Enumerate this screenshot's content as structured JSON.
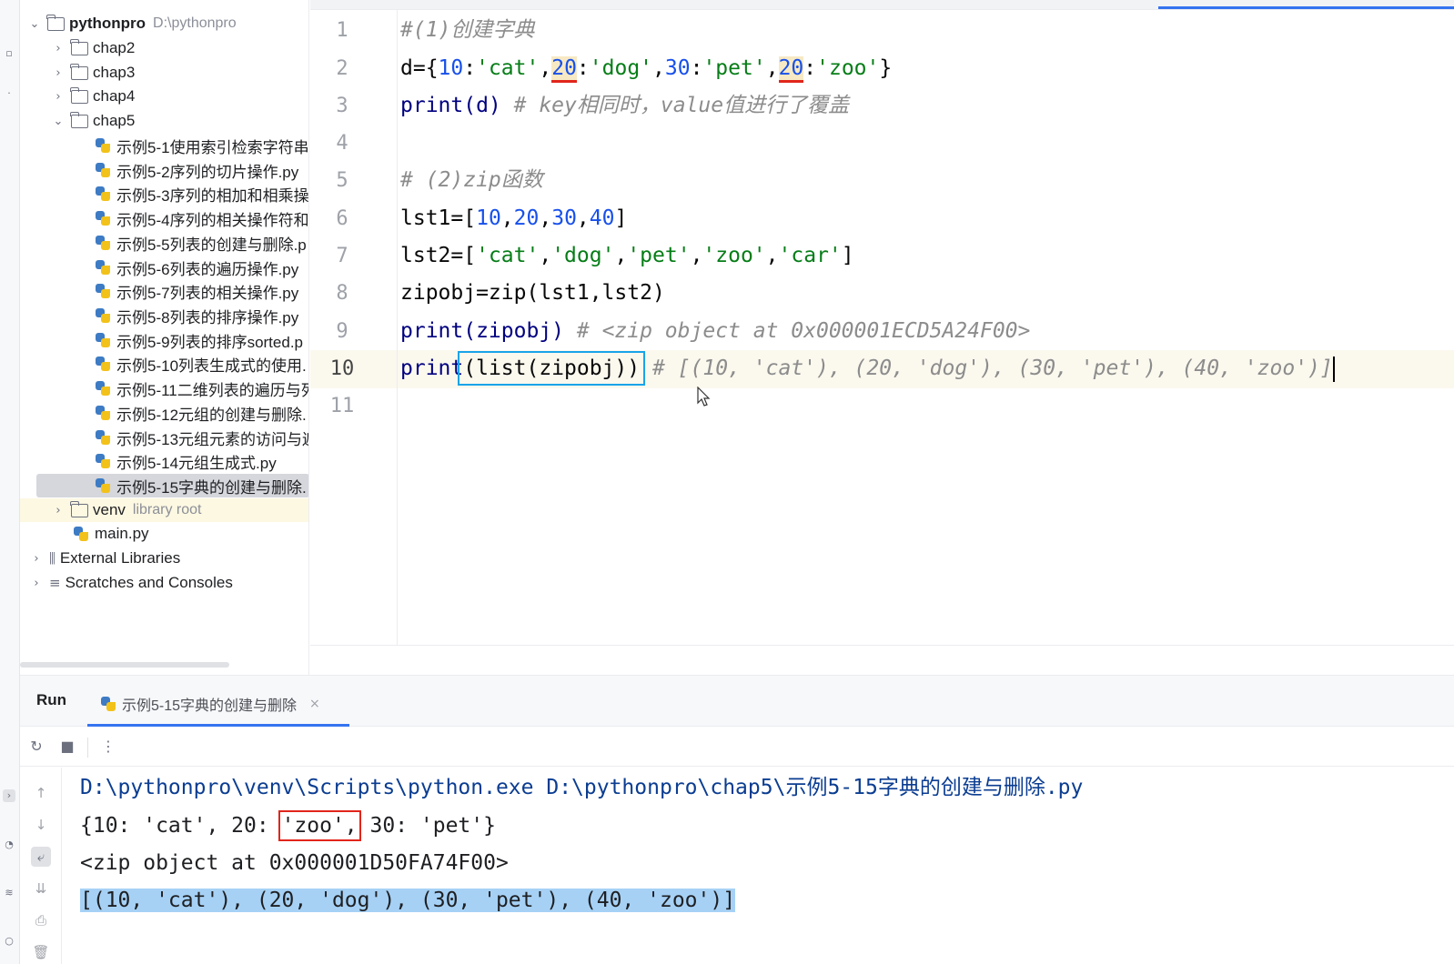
{
  "project": {
    "root_name": "pythonpro",
    "root_path": "D:\\pythonpro",
    "folders": [
      "chap2",
      "chap3",
      "chap4",
      "chap5"
    ],
    "files": [
      "示例5-1使用索引检索字符串",
      "示例5-2序列的切片操作.py",
      "示例5-3序列的相加和相乘操",
      "示例5-4序列的相关操作符和",
      "示例5-5列表的创建与删除.p",
      "示例5-6列表的遍历操作.py",
      "示例5-7列表的相关操作.py",
      "示例5-8列表的排序操作.py",
      "示例5-9列表的排序sorted.p",
      "示例5-10列表生成式的使用.",
      "示例5-11二维列表的遍历与列",
      "示例5-12元组的创建与删除.",
      "示例5-13元组元素的访问与遍",
      "示例5-14元组生成式.py",
      "示例5-15字典的创建与删除."
    ],
    "venv": "venv",
    "venv_hint": "library root",
    "main_file": "main.py",
    "external_libraries": "External Libraries",
    "scratches": "Scratches and Consoles"
  },
  "editor": {
    "line_numbers": [
      "1",
      "2",
      "3",
      "4",
      "5",
      "6",
      "7",
      "8",
      "9",
      "10",
      "11"
    ],
    "l1": "#(1)创建字典",
    "l2": {
      "a": "d={",
      "n10": "10",
      "c1": ":",
      "s_cat": "'cat'",
      "cm1": ",",
      "n20a": "20",
      "c2": ":",
      "s_dog": "'dog'",
      "cm2": ",",
      "n30": "30",
      "c3": ":",
      "s_pet": "'pet'",
      "cm3": ",",
      "n20b": "20",
      "c4": ":",
      "s_zoo": "'zoo'",
      "end": "}"
    },
    "l3": {
      "code": "print(d) ",
      "comment": "# key相同时，value值进行了覆盖"
    },
    "l5": "# (2)zip函数",
    "l6": {
      "a": "lst1=[",
      "n1": "10",
      "c1": ",",
      "n2": "20",
      "c2": ",",
      "n3": "30",
      "c3": ",",
      "n4": "40",
      "end": "]"
    },
    "l7": {
      "a": "lst2=[",
      "s1": "'cat'",
      "c1": ",",
      "s2": "'dog'",
      "c2": ",",
      "s3": "'pet'",
      "c3": ",",
      "s4": "'zoo'",
      "c4": ",",
      "s5": "'car'",
      "end": "]"
    },
    "l8": "zipobj=zip(lst1,lst2)",
    "l9": {
      "code": "print(zipobj) ",
      "comment": "# <zip object at 0x000001ECD5A24F00>"
    },
    "l10": {
      "fn": "print",
      "boxed": "(list(zipobj))",
      "sp": " ",
      "comment": "# [(10, 'cat'), (20, 'dog'), (30, 'pet'), (40, 'zoo')]"
    }
  },
  "run": {
    "title": "Run",
    "tab_label": "示例5-15字典的创建与删除",
    "tab_close": "×",
    "output": {
      "cmd": "D:\\pythonpro\\venv\\Scripts\\python.exe D:\\pythonpro\\chap5\\示例5-15字典的创建与删除.py",
      "dict_pre": "{10: 'cat', 20: ",
      "dict_box": "'zoo',",
      "dict_post": " 30: 'pet'}",
      "zip_line": "<zip object at 0x000001D50FA74F00>",
      "list_line": "[(10, 'cat'), (20, 'dog'), (30, 'pet'), (40, 'zoo')]"
    }
  },
  "colors": {
    "number": "#1750eb",
    "string": "#067d17",
    "comment": "#8c8c8c",
    "selection": "#a6d1f5",
    "annotation_red": "#e1251b",
    "annotation_blue": "#19a4ea"
  }
}
